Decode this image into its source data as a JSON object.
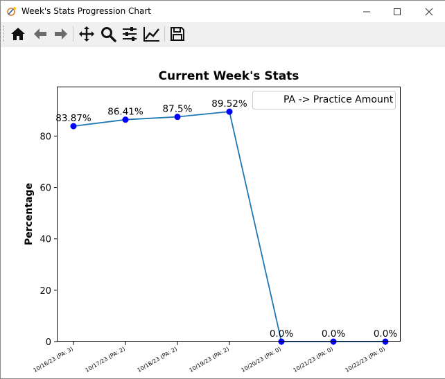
{
  "window": {
    "title": "Week's Stats Progression Chart"
  },
  "toolbar": {
    "buttons": [
      "home-icon",
      "back-arrow-icon",
      "forward-arrow-icon",
      "pan-icon",
      "zoom-icon",
      "configure-subplots-icon",
      "edit-axis-icon",
      "save-icon"
    ]
  },
  "chart_data": {
    "type": "line",
    "title": "Current Week's Stats",
    "xlabel": "",
    "ylabel": "Percentage",
    "categories": [
      "10/16/23 (PA: 3)",
      "10/17/23 (PA: 2)",
      "10/18/23 (PA: 2)",
      "10/19/23 (PA: 2)",
      "10/20/23 (PA: 0)",
      "10/21/23 (PA: 0)",
      "10/22/23 (PA: 0)"
    ],
    "values": [
      83.87,
      86.41,
      87.5,
      89.52,
      0.0,
      0.0,
      0.0
    ],
    "data_labels": [
      "83.87%",
      "86.41%",
      "87.5%",
      "89.52%",
      "0.0%",
      "0.0%",
      "0.0%"
    ],
    "ylim": [
      0,
      99
    ],
    "yticks": [
      0,
      20,
      40,
      60,
      80
    ],
    "legend": {
      "entries": [
        "PA -> Practice Amount"
      ],
      "placement": "top-right"
    },
    "grid": false,
    "line_color": "#1f77b4",
    "marker_color": "#0000ff"
  }
}
